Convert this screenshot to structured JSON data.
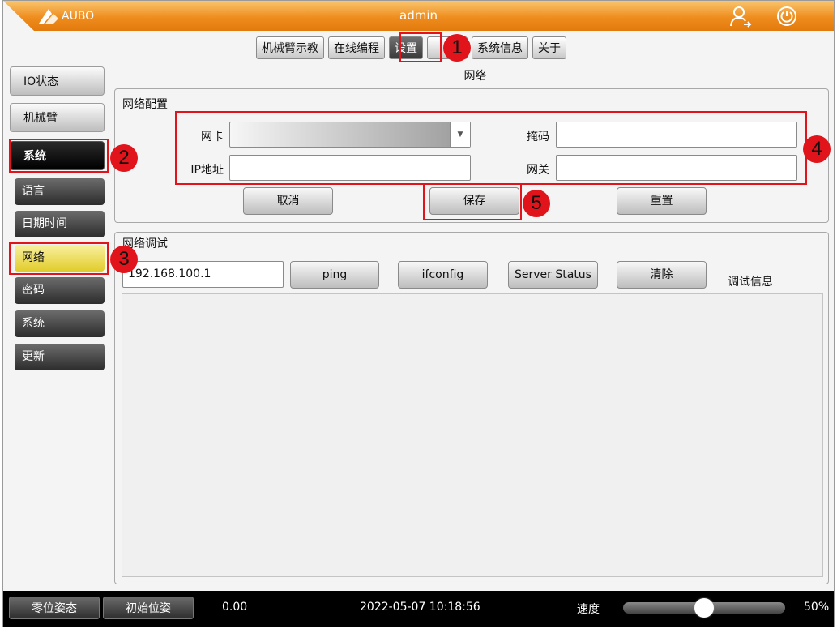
{
  "header": {
    "logo_text": "AUBO",
    "title": "admin",
    "user_icon": "user-logout-icon",
    "power_icon": "power-icon"
  },
  "tabs": [
    {
      "label": "机械臂示教",
      "active": false
    },
    {
      "label": "在线编程",
      "active": false
    },
    {
      "label": "设置",
      "active": true
    },
    {
      "label": "",
      "active": false
    },
    {
      "label": "系统信息",
      "active": false
    },
    {
      "label": "关于",
      "active": false
    }
  ],
  "section_title": "网络",
  "sidebar": {
    "items": [
      {
        "label": "IO状态"
      },
      {
        "label": "机械臂"
      },
      {
        "label": "系统"
      }
    ],
    "sub_items": [
      {
        "label": "语言"
      },
      {
        "label": "日期时间"
      },
      {
        "label": "网络"
      },
      {
        "label": "密码"
      },
      {
        "label": "系统"
      },
      {
        "label": "更新"
      }
    ]
  },
  "network_config": {
    "title": "网络配置",
    "nic_label": "网卡",
    "nic_value": "",
    "ip_label": "IP地址",
    "ip_value": "",
    "mask_label": "掩码",
    "mask_value": "",
    "gateway_label": "网关",
    "gateway_value": "",
    "cancel_label": "取消",
    "save_label": "保存",
    "reset_label": "重置"
  },
  "network_debug": {
    "title": "网络调试",
    "ip_value": "192.168.100.1",
    "ping_label": "ping",
    "ifconfig_label": "ifconfig",
    "server_status_label": "Server Status",
    "clear_label": "清除",
    "debug_info_label": "调试信息"
  },
  "annotations": [
    "1",
    "2",
    "3",
    "4",
    "5"
  ],
  "footer": {
    "zero_pose_label": "零位姿态",
    "init_pose_label": "初始位姿",
    "value": "0.00",
    "datetime": "2022-05-07 10:18:56",
    "speed_label": "速度",
    "speed_percent": "50%",
    "speed_fraction": 0.5
  },
  "colors": {
    "header": "#ef8d1e",
    "annotation_red": "#e2141b",
    "selected_item": "#e2cc2a"
  }
}
